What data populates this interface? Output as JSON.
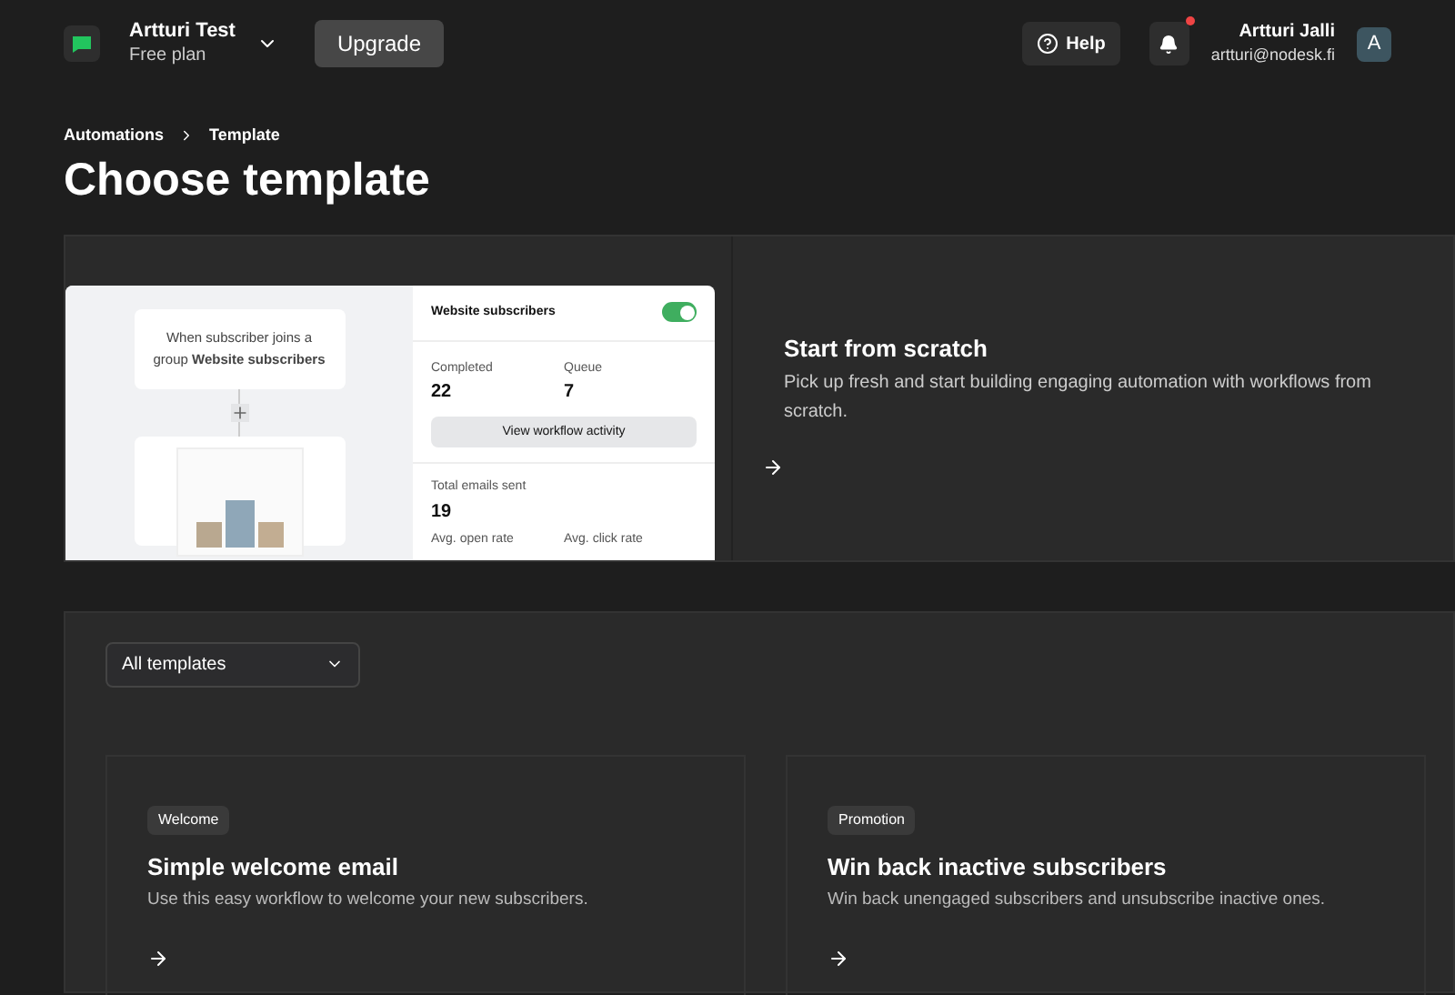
{
  "account": {
    "name": "Artturi Test",
    "plan": "Free plan"
  },
  "upgrade_button": "Upgrade",
  "help_button": "Help",
  "notifications": {
    "unread": true
  },
  "user": {
    "name": "Artturi Jalli",
    "email": "artturi@nodesk.fi",
    "initial": "A"
  },
  "breadcrumb": [
    "Automations",
    "Template"
  ],
  "title": "Choose template",
  "preview": {
    "trigger": "When subscriber joins a group **Website subscribers**",
    "group": "Website subscribers",
    "enabled": true,
    "stats": [
      {
        "label": "Completed",
        "value": "22"
      },
      {
        "label": "Queue",
        "value": "7"
      }
    ],
    "activity_button": "View workflow activity",
    "total_label": "Total emails sent",
    "total_value": "19",
    "rates": [
      "Avg. open rate",
      "Avg. click rate"
    ]
  },
  "scratch": {
    "title": "Start from scratch",
    "description": "Pick up fresh and start building engaging automation with workflows from scratch."
  },
  "filter": {
    "value": "All templates"
  },
  "templates": [
    {
      "tag": "Welcome",
      "title": "Simple welcome email",
      "description": "Use this easy workflow to welcome your new subscribers."
    },
    {
      "tag": "Promotion",
      "title": "Win back inactive subscribers",
      "description": "Win back unengaged subscribers and unsubscribe inactive ones."
    }
  ]
}
